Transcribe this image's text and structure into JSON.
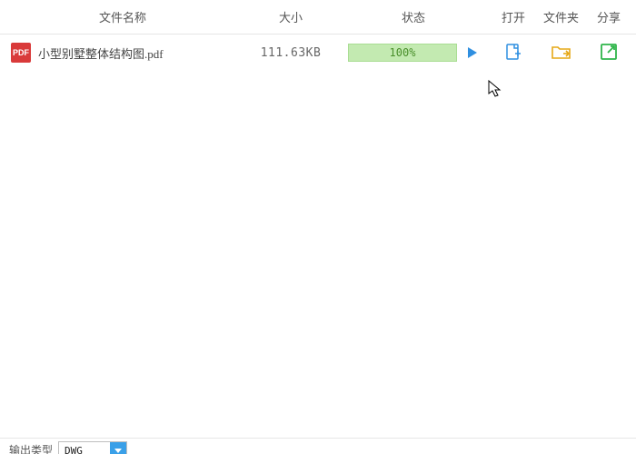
{
  "headers": {
    "name": "文件名称",
    "size": "大小",
    "status": "状态",
    "open": "打开",
    "folder": "文件夹",
    "share": "分享"
  },
  "row": {
    "badge": "PDF",
    "filename": "小型别墅整体结构图.pdf",
    "size": "111.63KB",
    "progress": "100%"
  },
  "bottom": {
    "output_type_label": "输出类型",
    "output_type_value": "DWG"
  },
  "icons": {
    "play": "play-icon",
    "open": "open-file-icon",
    "folder": "folder-icon",
    "share": "share-icon",
    "pdf": "pdf-icon",
    "dropdown": "chevron-down-icon"
  }
}
